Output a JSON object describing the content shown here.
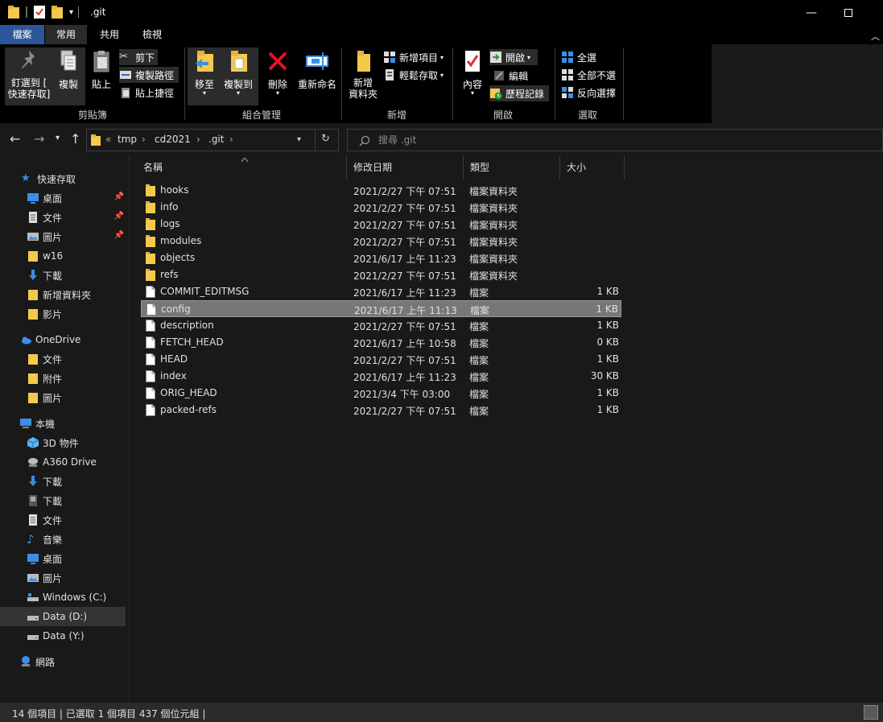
{
  "window": {
    "title": ".git"
  },
  "ribbon_tabs": [
    "檔案",
    "常用",
    "共用",
    "檢視"
  ],
  "ribbon": {
    "clipboard": {
      "label": "剪貼簿",
      "pin": "釘選到 [\n快速存取]",
      "copy": "複製",
      "paste": "貼上",
      "cut": "剪下",
      "copy_path": "複製路徑",
      "paste_shortcut": "貼上捷徑"
    },
    "organize": {
      "label": "組合管理",
      "move_to": "移至",
      "copy_to": "複製到",
      "delete": "刪除",
      "rename": "重新命名"
    },
    "new": {
      "label": "新增",
      "new_folder": "新增\n資料夾",
      "new_item": "新增項目",
      "easy_access": "輕鬆存取"
    },
    "open": {
      "label": "開啟",
      "properties": "內容",
      "open": "開啟",
      "edit": "編輯",
      "history": "歷程記錄"
    },
    "select": {
      "label": "選取",
      "select_all": "全選",
      "select_none": "全部不選",
      "invert": "反向選擇"
    }
  },
  "address": {
    "overflow": "«",
    "crumbs": [
      "tmp",
      "cd2021",
      ".git"
    ],
    "search_placeholder": "搜尋 .git"
  },
  "nav": {
    "quick_access": "快速存取",
    "quick_items": [
      "桌面",
      "文件",
      "圖片",
      "w16",
      "下載",
      "新增資料夾",
      "影片"
    ],
    "onedrive": "OneDrive",
    "onedrive_items": [
      "文件",
      "附件",
      "圖片"
    ],
    "this_pc": "本機",
    "pc_items": [
      "3D 物件",
      "A360 Drive",
      "下載",
      "下載",
      "文件",
      "音樂",
      "桌面",
      "圖片",
      "Windows (C:)",
      "Data (D:)",
      "Data (Y:)"
    ],
    "network": "網路"
  },
  "columns": {
    "name": "名稱",
    "date": "修改日期",
    "type": "類型",
    "size": "大小"
  },
  "files": [
    {
      "name": "hooks",
      "date": "2021/2/27 下午 07:51",
      "type": "檔案資料夾",
      "size": "",
      "kind": "folder"
    },
    {
      "name": "info",
      "date": "2021/2/27 下午 07:51",
      "type": "檔案資料夾",
      "size": "",
      "kind": "folder"
    },
    {
      "name": "logs",
      "date": "2021/2/27 下午 07:51",
      "type": "檔案資料夾",
      "size": "",
      "kind": "folder"
    },
    {
      "name": "modules",
      "date": "2021/2/27 下午 07:51",
      "type": "檔案資料夾",
      "size": "",
      "kind": "folder"
    },
    {
      "name": "objects",
      "date": "2021/6/17 上午 11:23",
      "type": "檔案資料夾",
      "size": "",
      "kind": "folder"
    },
    {
      "name": "refs",
      "date": "2021/2/27 下午 07:51",
      "type": "檔案資料夾",
      "size": "",
      "kind": "folder"
    },
    {
      "name": "COMMIT_EDITMSG",
      "date": "2021/6/17 上午 11:23",
      "type": "檔案",
      "size": "1 KB",
      "kind": "file"
    },
    {
      "name": "config",
      "date": "2021/6/17 上午 11:13",
      "type": "檔案",
      "size": "1 KB",
      "kind": "file",
      "selected": true
    },
    {
      "name": "description",
      "date": "2021/2/27 下午 07:51",
      "type": "檔案",
      "size": "1 KB",
      "kind": "file"
    },
    {
      "name": "FETCH_HEAD",
      "date": "2021/6/17 上午 10:58",
      "type": "檔案",
      "size": "0 KB",
      "kind": "file"
    },
    {
      "name": "HEAD",
      "date": "2021/2/27 下午 07:51",
      "type": "檔案",
      "size": "1 KB",
      "kind": "file"
    },
    {
      "name": "index",
      "date": "2021/6/17 上午 11:23",
      "type": "檔案",
      "size": "30 KB",
      "kind": "file"
    },
    {
      "name": "ORIG_HEAD",
      "date": "2021/3/4 下午 03:00",
      "type": "檔案",
      "size": "1 KB",
      "kind": "file"
    },
    {
      "name": "packed-refs",
      "date": "2021/2/27 下午 07:51",
      "type": "檔案",
      "size": "1 KB",
      "kind": "file"
    }
  ],
  "status": {
    "text": "14 個項目  |  已選取 1 個項目  437 個位元組  |"
  },
  "colors": {
    "file_tab": "#2b579a",
    "folder": "#f5c94c",
    "selection": "#777777",
    "background": "#191919"
  }
}
